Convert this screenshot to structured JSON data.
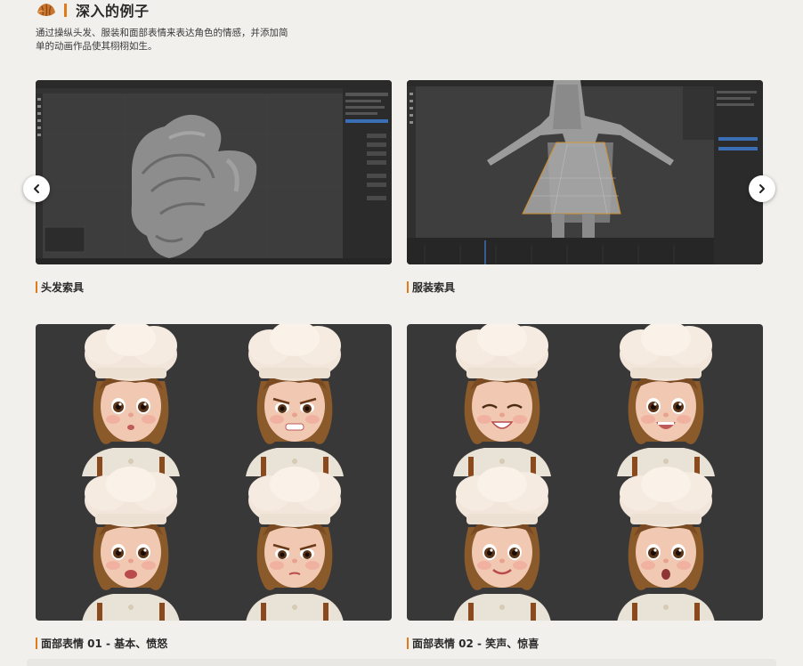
{
  "section": {
    "title": "深入的例子",
    "description": "通过操纵头发、服装和面部表情来表达角色的情感，并添加简单的动画作品使其栩栩如生。"
  },
  "gallery": {
    "items": [
      {
        "caption": "头发索具"
      },
      {
        "caption": "服装索具"
      },
      {
        "caption": "面部表情 01 - 基本、愤怒"
      },
      {
        "caption": "面部表情 02 - 笑声、惊喜"
      }
    ]
  },
  "icons": {
    "logo": "croissant-icon",
    "prev": "chevron-left-icon",
    "next": "chevron-right-icon"
  },
  "colors": {
    "background": "#f2f0ec",
    "accent": "#e07b1a",
    "render_bg": "#383838"
  }
}
